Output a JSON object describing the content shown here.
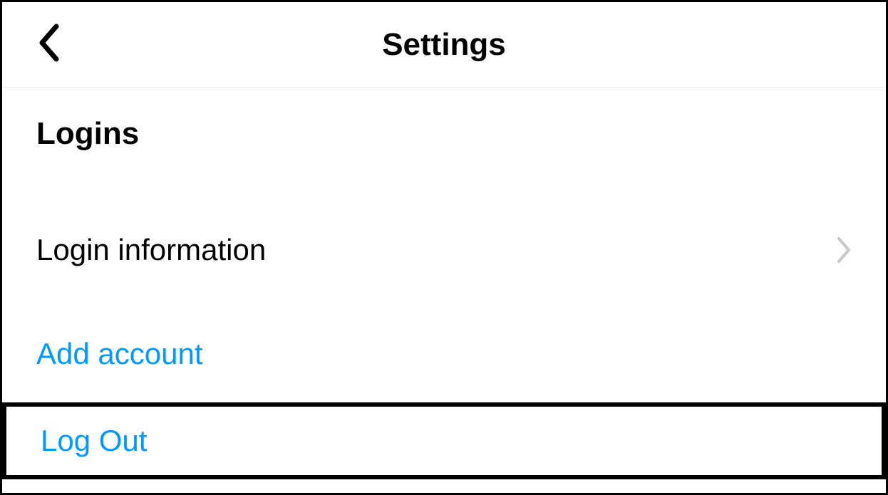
{
  "header": {
    "title": "Settings"
  },
  "section": {
    "title": "Logins"
  },
  "rows": {
    "login_info": "Login information",
    "add_account": "Add account",
    "log_out": "Log Out"
  },
  "colors": {
    "link": "#0099ff"
  }
}
